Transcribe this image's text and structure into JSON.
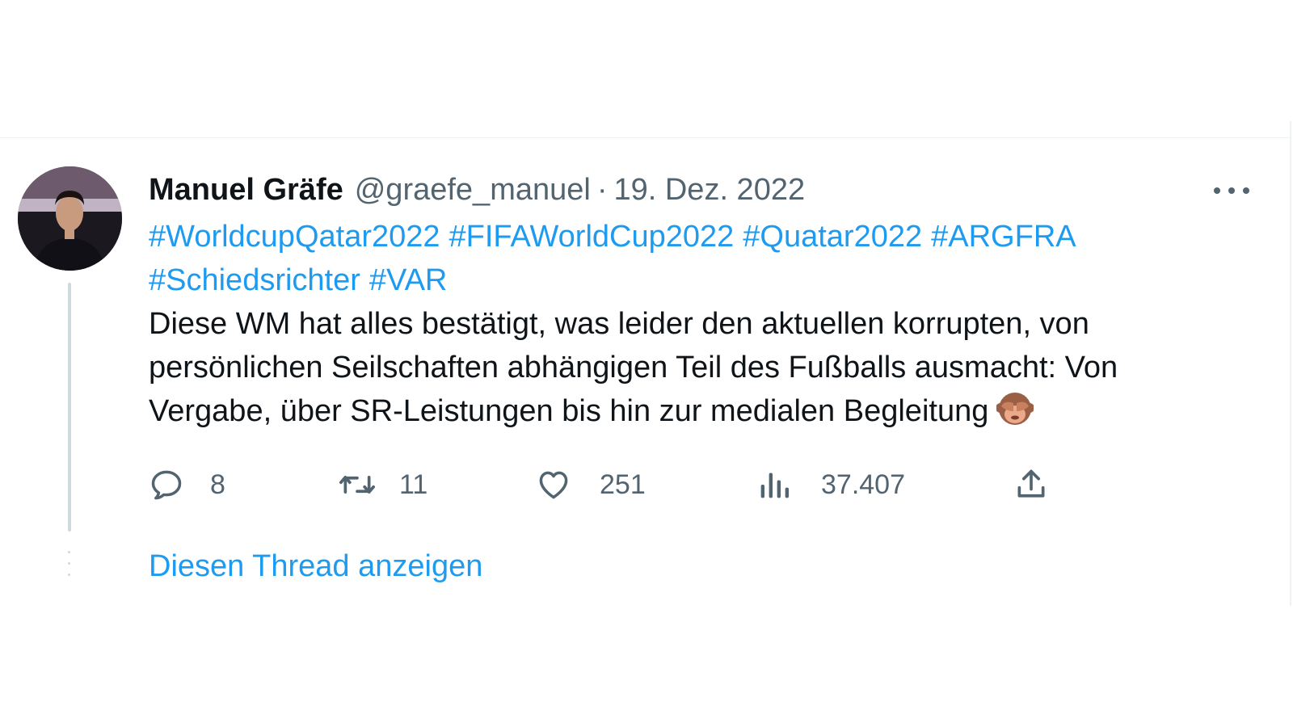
{
  "tweet": {
    "author_name": "Manuel Gräfe",
    "handle": "@graefe_manuel",
    "separator": "·",
    "date": "19. Dez. 2022",
    "hashtags": [
      "#WorldcupQatar2022",
      "#FIFAWorldCup2022",
      "#Quatar2022",
      "#ARGFRA",
      "#Schiedsrichter",
      "#VAR"
    ],
    "text": "Diese WM hat alles bestätigt, was leider den aktuellen korrupten, von persönlichen Seilschaften abhängigen Teil des Fußballs ausmacht: Von Vergabe, über SR-Leistungen bis hin zur medialen Begleitung",
    "emoji": "see-no-evil-monkey"
  },
  "actions": {
    "replies": "8",
    "retweets": "11",
    "likes": "251",
    "views": "37.407"
  },
  "show_thread": "Diesen Thread anzeigen",
  "colors": {
    "link": "#1d9bf0",
    "secondary_text": "#536471",
    "primary_text": "#0f1419",
    "thread_line": "#cfd9de"
  }
}
